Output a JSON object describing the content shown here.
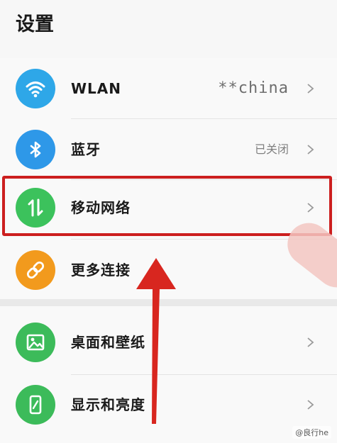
{
  "header": {
    "title": "设置"
  },
  "settings": [
    {
      "label": "WLAN",
      "value": "**china"
    },
    {
      "label": "蓝牙",
      "value": "已关闭"
    },
    {
      "label": "移动网络",
      "value": ""
    },
    {
      "label": "更多连接",
      "value": ""
    },
    {
      "label": "桌面和壁纸",
      "value": ""
    },
    {
      "label": "显示和亮度",
      "value": ""
    }
  ],
  "icons": {
    "wlan": "wifi-icon",
    "bluetooth": "bluetooth-icon",
    "mobile": "mobile-data-icon",
    "more": "link-icon",
    "desktop": "wallpaper-icon",
    "display": "display-icon"
  },
  "colors": {
    "wlan": "#2ea7e8",
    "bluetooth": "#2e98e8",
    "mobile": "#3cc25c",
    "more": "#f29a1d",
    "desktop": "#3cbb5a",
    "display": "#3cbb5a",
    "highlight": "#cc1f1f"
  },
  "watermark": "@良行he"
}
